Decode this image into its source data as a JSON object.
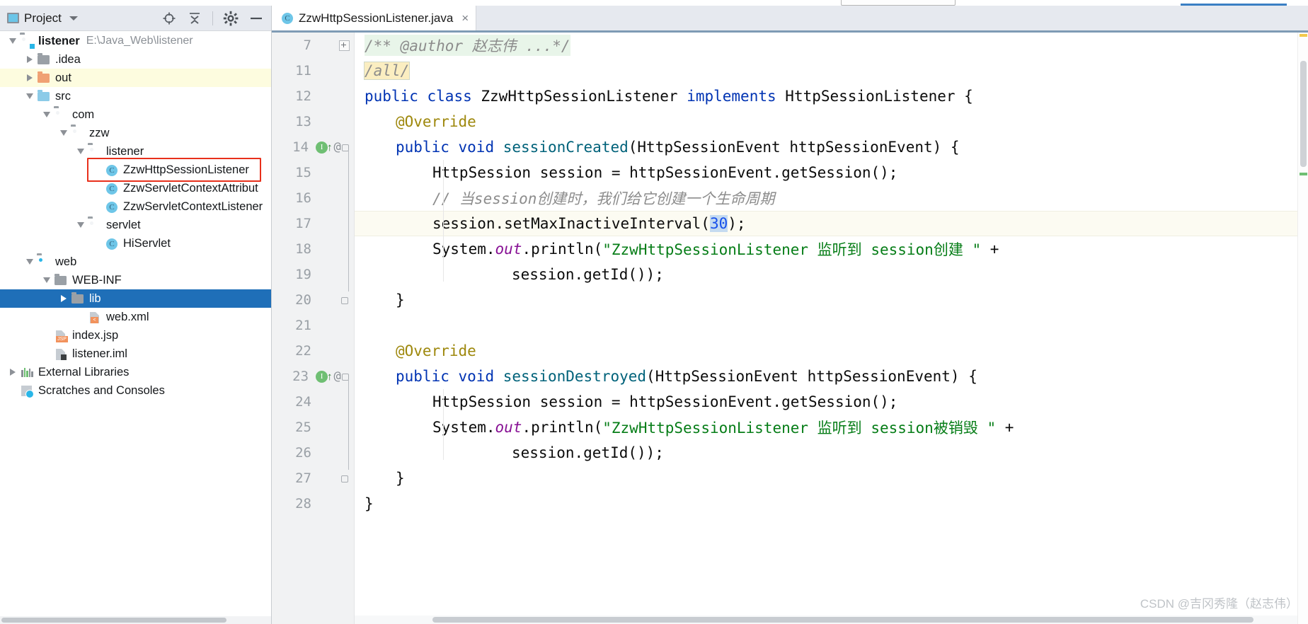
{
  "panel": {
    "title": "Project",
    "icons": {
      "locate": "crosshair-target-icon",
      "collapse": "collapse-all-icon",
      "settings": "gear-icon",
      "hide": "minimize-icon",
      "dropdown": "chevron-down-icon"
    }
  },
  "tree": [
    {
      "id": "listener-root",
      "label": "listener",
      "path": "E:\\Java_Web\\listener",
      "indent": 0,
      "arrow": "down",
      "icon": "module-folder",
      "bold": true,
      "state": "normal"
    },
    {
      "id": "idea",
      "label": ".idea",
      "path": "",
      "indent": 1,
      "arrow": "right",
      "icon": "folder-gray",
      "bold": false,
      "state": "normal"
    },
    {
      "id": "out",
      "label": "out",
      "path": "",
      "indent": 1,
      "arrow": "right",
      "icon": "folder-orange",
      "bold": false,
      "state": "highlight"
    },
    {
      "id": "src",
      "label": "src",
      "path": "",
      "indent": 1,
      "arrow": "down",
      "icon": "folder-blue",
      "bold": false,
      "state": "normal"
    },
    {
      "id": "com",
      "label": "com",
      "path": "",
      "indent": 2,
      "arrow": "down",
      "icon": "folder-package",
      "bold": false,
      "state": "normal"
    },
    {
      "id": "zzw",
      "label": "zzw",
      "path": "",
      "indent": 3,
      "arrow": "down",
      "icon": "folder-package",
      "bold": false,
      "state": "normal"
    },
    {
      "id": "listener-pkg",
      "label": "listener",
      "path": "",
      "indent": 4,
      "arrow": "down",
      "icon": "folder-package",
      "bold": false,
      "state": "normal"
    },
    {
      "id": "cls-zzwhttp",
      "label": "ZzwHttpSessionListener",
      "path": "",
      "indent": 5,
      "arrow": "none",
      "icon": "java-class",
      "bold": false,
      "state": "outlined"
    },
    {
      "id": "cls-zzwattr",
      "label": "ZzwServletContextAttribut",
      "path": "",
      "indent": 5,
      "arrow": "none",
      "icon": "java-class",
      "bold": false,
      "state": "normal"
    },
    {
      "id": "cls-zzwctx",
      "label": "ZzwServletContextListener",
      "path": "",
      "indent": 5,
      "arrow": "none",
      "icon": "java-class",
      "bold": false,
      "state": "normal"
    },
    {
      "id": "servlet-pkg",
      "label": "servlet",
      "path": "",
      "indent": 4,
      "arrow": "down",
      "icon": "folder-package",
      "bold": false,
      "state": "normal"
    },
    {
      "id": "cls-hiservlet",
      "label": "HiServlet",
      "path": "",
      "indent": 5,
      "arrow": "none",
      "icon": "java-class",
      "bold": false,
      "state": "normal"
    },
    {
      "id": "web",
      "label": "web",
      "path": "",
      "indent": 1,
      "arrow": "down",
      "icon": "folder-webmod",
      "bold": false,
      "state": "normal"
    },
    {
      "id": "web-inf",
      "label": "WEB-INF",
      "path": "",
      "indent": 2,
      "arrow": "down",
      "icon": "folder-gray",
      "bold": false,
      "state": "normal"
    },
    {
      "id": "lib",
      "label": "lib",
      "path": "",
      "indent": 3,
      "arrow": "right",
      "icon": "folder-gray",
      "bold": false,
      "state": "selected"
    },
    {
      "id": "web-xml",
      "label": "web.xml",
      "path": "",
      "indent": 4,
      "arrow": "none",
      "icon": "xml-file",
      "bold": false,
      "state": "normal"
    },
    {
      "id": "index-jsp",
      "label": "index.jsp",
      "path": "",
      "indent": 2,
      "arrow": "none",
      "icon": "jsp-file",
      "bold": false,
      "state": "normal"
    },
    {
      "id": "listener-iml",
      "label": "listener.iml",
      "path": "",
      "indent": 2,
      "arrow": "none",
      "icon": "iml-file",
      "bold": false,
      "state": "normal"
    },
    {
      "id": "external-libs",
      "label": "External Libraries",
      "path": "",
      "indent": 0,
      "arrow": "right",
      "icon": "external-libraries",
      "bold": false,
      "state": "normal"
    },
    {
      "id": "scratches",
      "label": "Scratches and Consoles",
      "path": "",
      "indent": 0,
      "arrow": "none",
      "icon": "scratches",
      "bold": false,
      "state": "normal"
    }
  ],
  "editor": {
    "tab": {
      "label": "ZzwHttpSessionListener.java",
      "icon": "java-class",
      "close": "×"
    },
    "lines": [
      {
        "num": "7",
        "fold": "plus",
        "gutter": []
      },
      {
        "num": "11",
        "fold": "none",
        "gutter": []
      },
      {
        "num": "12",
        "fold": "none",
        "gutter": []
      },
      {
        "num": "13",
        "fold": "none",
        "gutter": []
      },
      {
        "num": "14",
        "fold": "brace",
        "gutter": [
          "implementing-method-marker",
          "override-marker"
        ]
      },
      {
        "num": "15",
        "fold": "none",
        "gutter": []
      },
      {
        "num": "16",
        "fold": "none",
        "gutter": []
      },
      {
        "num": "17",
        "fold": "none",
        "gutter": []
      },
      {
        "num": "18",
        "fold": "none",
        "gutter": []
      },
      {
        "num": "19",
        "fold": "none",
        "gutter": []
      },
      {
        "num": "20",
        "fold": "brace",
        "gutter": []
      },
      {
        "num": "21",
        "fold": "none",
        "gutter": []
      },
      {
        "num": "22",
        "fold": "none",
        "gutter": []
      },
      {
        "num": "23",
        "fold": "brace",
        "gutter": [
          "implementing-method-marker",
          "override-marker"
        ]
      },
      {
        "num": "24",
        "fold": "none",
        "gutter": []
      },
      {
        "num": "25",
        "fold": "none",
        "gutter": []
      },
      {
        "num": "26",
        "fold": "none",
        "gutter": []
      },
      {
        "num": "27",
        "fold": "brace",
        "gutter": []
      },
      {
        "num": "28",
        "fold": "none",
        "gutter": []
      }
    ],
    "code": {
      "l7_fold_comment": "/** @author 赵志伟 ...*/",
      "l11_fold_all": "/all/",
      "l12_kw_public": "public",
      "l12_kw_class": "class",
      "l12_name": "ZzwHttpSessionListener",
      "l12_kw_implements": "implements",
      "l12_iface": "HttpSessionListener {",
      "l13_override": "@Override",
      "l14_public": "public",
      "l14_void": "void",
      "l14_method": "sessionCreated",
      "l14_params": "(HttpSessionEvent httpSessionEvent) {",
      "l15": "HttpSession session = httpSessionEvent.getSession();",
      "l16_comment": "// 当session创建时，我们给它创建一个生命周期",
      "l17_pre": "session.setMaxInactiveInterval(",
      "l17_num": "30",
      "l17_post": ");",
      "l18_system": "System.",
      "l18_out": "out",
      "l18_println": ".println(",
      "l18_str": "\"ZzwHttpSessionListener 监听到 session创建 \"",
      "l18_plus": " +",
      "l19": "session.getId());",
      "l20": "}",
      "l22_override": "@Override",
      "l23_public": "public",
      "l23_void": "void",
      "l23_method": "sessionDestroyed",
      "l23_params": "(HttpSessionEvent httpSessionEvent) {",
      "l24": "HttpSession session = httpSessionEvent.getSession();",
      "l25_system": "System.",
      "l25_out": "out",
      "l25_println": ".println(",
      "l25_str": "\"ZzwHttpSessionListener 监听到 session被销毁 \"",
      "l25_plus": " +",
      "l26": "session.getId());",
      "l27": "}",
      "l28": "}"
    }
  },
  "watermark": "CSDN @吉冈秀隆（赵志伟）",
  "colors": {
    "selection_blue": "#1f6fb8",
    "highlight_yellow": "#fdfcdf",
    "red_outline": "#e8301b",
    "keyword_blue": "#0033b3",
    "string_green": "#067d17",
    "annotation_gold": "#9e880d",
    "method_teal": "#00627a",
    "comment_gray": "#8c8c8c",
    "number_blue": "#1750eb",
    "field_purple": "#871094"
  }
}
